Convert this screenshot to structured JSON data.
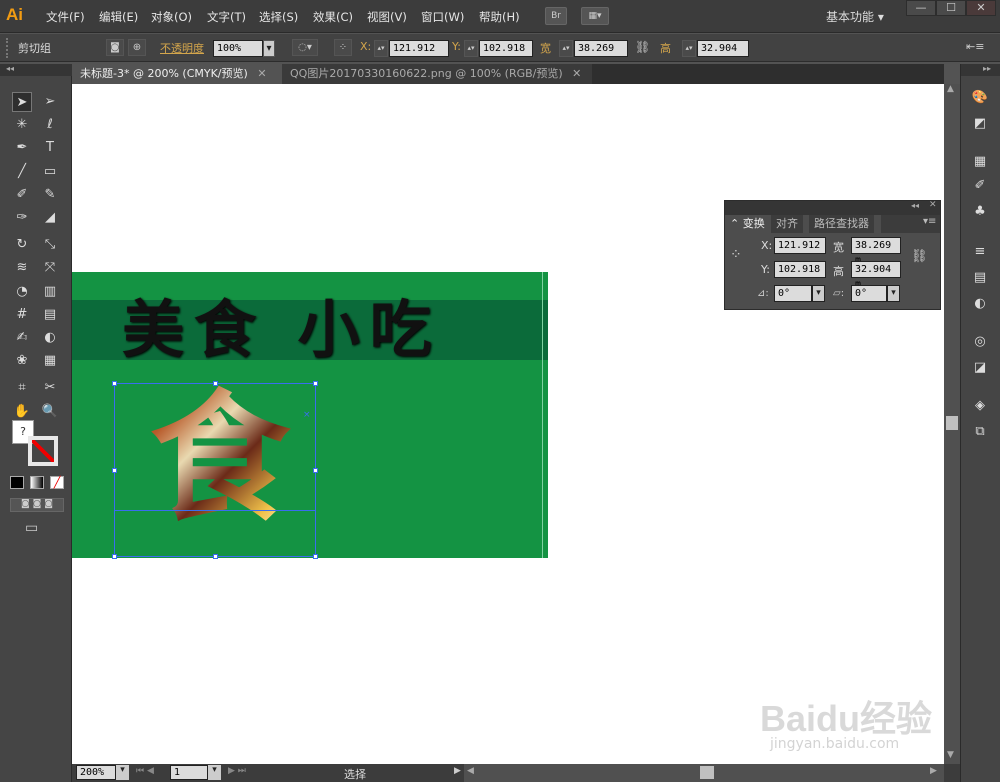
{
  "app": {
    "logo": "Ai",
    "workspace": "基本功能"
  },
  "menus": [
    "文件(F)",
    "编辑(E)",
    "对象(O)",
    "文字(T)",
    "选择(S)",
    "效果(C)",
    "视图(V)",
    "窗口(W)",
    "帮助(H)"
  ],
  "menubar_buttons": {
    "bridge": "Br",
    "arrange": "▦▾"
  },
  "window_controls": {
    "minimize": "—",
    "maximize": "☐",
    "close": "✕"
  },
  "control_bar": {
    "selection_label": "剪切组",
    "opacity_label": "不透明度",
    "opacity_value": "100%",
    "x_label": "X:",
    "x_value": "121.912",
    "y_label": "Y:",
    "y_value": "102.918",
    "w_label": "宽",
    "w_value": "38.269 mi",
    "h_label": "高",
    "h_value": "32.904 mi"
  },
  "tabs": [
    {
      "label": "未标题-3* @ 200% (CMYK/预览)",
      "active": true,
      "close": "✕"
    },
    {
      "label": "QQ图片20170330160622.png @ 100% (RGB/预览)",
      "active": false,
      "close": "✕"
    }
  ],
  "artwork": {
    "title": "美食 小吃",
    "food_glyph": "食"
  },
  "transform_panel": {
    "tabs": [
      "变换",
      "对齐",
      "路径查找器"
    ],
    "x_label": "X:",
    "x_value": "121.912",
    "y_label": "Y:",
    "y_value": "102.918",
    "w_label": "宽",
    "w_value": "38.269 m",
    "h_label": "高",
    "h_value": "32.904 m",
    "rotate_value": "0°",
    "shear_value": "0°"
  },
  "status_bar": {
    "zoom": "200%",
    "page": "1",
    "tool": "选择"
  },
  "watermark": {
    "line1": "Baidu经验",
    "line2": "jingyan.baidu.com"
  },
  "tools_left": [
    "selection-tool",
    "direct-selection-tool",
    "magic-wand-tool",
    "lasso-tool",
    "pen-tool",
    "type-tool",
    "line-tool",
    "rectangle-tool",
    "paintbrush-tool",
    "pencil-tool",
    "blob-brush-tool",
    "eraser-tool",
    "rotate-tool",
    "scale-tool",
    "warp-tool",
    "free-transform-tool",
    "shape-builder-tool",
    "perspective-grid-tool",
    "mesh-tool",
    "gradient-tool",
    "eyedropper-tool",
    "blend-tool",
    "symbol-sprayer-tool",
    "column-graph-tool",
    "artboard-tool",
    "slice-tool",
    "hand-tool",
    "zoom-tool"
  ],
  "tools_left_glyphs": [
    "➤",
    "➢",
    "✳",
    "ℓ",
    "✒",
    "T",
    "╱",
    "▭",
    "✐",
    "✎",
    "✑",
    "◢",
    "↻",
    "⤡",
    "≋",
    "⤧",
    "◔",
    "▥",
    "#",
    "▤",
    "✍",
    "◐",
    "❀",
    "▦",
    "⌗",
    "✂",
    "✋",
    "🔍"
  ]
}
